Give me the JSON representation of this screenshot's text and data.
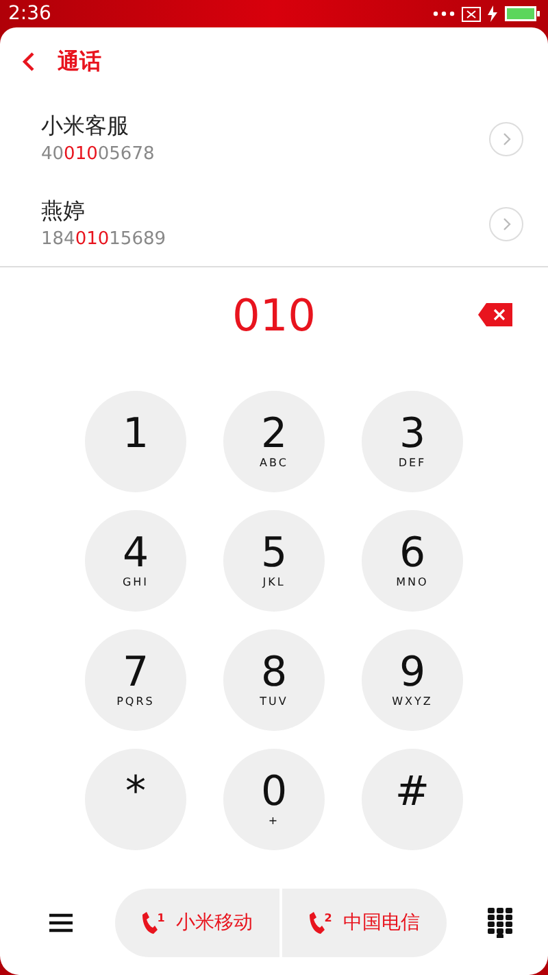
{
  "status_bar": {
    "time": "2:36"
  },
  "header": {
    "title": "通话"
  },
  "results": [
    {
      "name": "小米客服",
      "number_parts": [
        {
          "text": "40",
          "match": false
        },
        {
          "text": "010",
          "match": true
        },
        {
          "text": "05678",
          "match": false
        }
      ]
    },
    {
      "name": "燕婷",
      "number_parts": [
        {
          "text": "184",
          "match": false
        },
        {
          "text": "010",
          "match": true
        },
        {
          "text": "15689",
          "match": false
        }
      ]
    }
  ],
  "display": {
    "value": "010"
  },
  "keys": [
    {
      "digit": "1"
    },
    {
      "digit": "2",
      "letters": "ABC"
    },
    {
      "digit": "3",
      "letters": "DEF"
    },
    {
      "digit": "4",
      "letters": "GHI"
    },
    {
      "digit": "5",
      "letters": "JKL"
    },
    {
      "digit": "6",
      "letters": "MNO"
    },
    {
      "digit": "7",
      "letters": "PQRS"
    },
    {
      "digit": "8",
      "letters": "TUV"
    },
    {
      "digit": "9",
      "letters": "WXYZ"
    },
    {
      "digit": "*"
    },
    {
      "digit": "0",
      "letters": "+"
    },
    {
      "digit": "#"
    }
  ],
  "call_buttons": [
    {
      "sim": "1",
      "carrier": "小米移动"
    },
    {
      "sim": "2",
      "carrier": "中国电信"
    }
  ]
}
